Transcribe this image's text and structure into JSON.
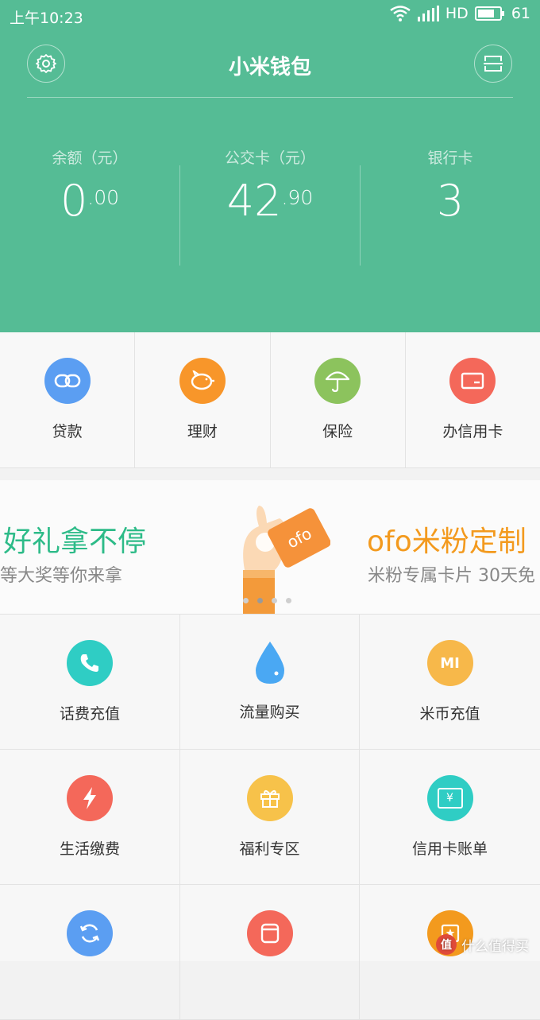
{
  "status_bar": {
    "time": "上午10:23",
    "network": "HD",
    "battery": "61"
  },
  "header": {
    "title": "小米钱包",
    "left_button_icon": "gear-icon",
    "right_button_icon": "scan-icon"
  },
  "stats": [
    {
      "label": "余额（元）",
      "value_main": "0",
      "value_decimal": ".00"
    },
    {
      "label": "公交卡（元）",
      "value_main": "42",
      "value_decimal": ".90"
    },
    {
      "label": "银行卡",
      "value_main": "3",
      "value_decimal": ""
    }
  ],
  "quick_actions": [
    {
      "label": "贷款",
      "icon": "link-icon",
      "color": "#5b9ef2"
    },
    {
      "label": "理财",
      "icon": "piggy-bank-icon",
      "color": "#f8962a"
    },
    {
      "label": "保险",
      "icon": "umbrella-icon",
      "color": "#8cc35d"
    },
    {
      "label": "办信用卡",
      "icon": "card-icon",
      "color": "#f4685a"
    }
  ],
  "banner": {
    "left_title": "好礼拿不停",
    "left_subtitle": "等大奖等你来拿",
    "right_title": "ofo米粉定制",
    "right_subtitle": "米粉专属卡片 30天免",
    "card_text": "ofo",
    "active_dot": 1
  },
  "services": [
    {
      "label": "话费充值",
      "icon": "phone-icon",
      "color": "#2fcdc4"
    },
    {
      "label": "流量购买",
      "icon": "droplet-icon",
      "color": "#4aa8f3"
    },
    {
      "label": "米币充值",
      "icon": "mi-coin-icon",
      "color": "#f7b84a",
      "glyph": "MI"
    },
    {
      "label": "生活缴费",
      "icon": "lightning-icon",
      "color": "#f4685a"
    },
    {
      "label": "福利专区",
      "icon": "gift-icon",
      "color": "#f7c24a"
    },
    {
      "label": "信用卡账单",
      "icon": "bill-icon",
      "color": "#2fcdc4",
      "glyph": "¥"
    },
    {
      "label": "",
      "icon": "refresh-icon",
      "color": "#5b9ef2"
    },
    {
      "label": "",
      "icon": "cylinder-icon",
      "color": "#f4685a"
    },
    {
      "label": "",
      "icon": "star-card-icon",
      "color": "#f39a1e"
    }
  ],
  "watermark": {
    "badge": "值",
    "text": "什么值得买"
  }
}
